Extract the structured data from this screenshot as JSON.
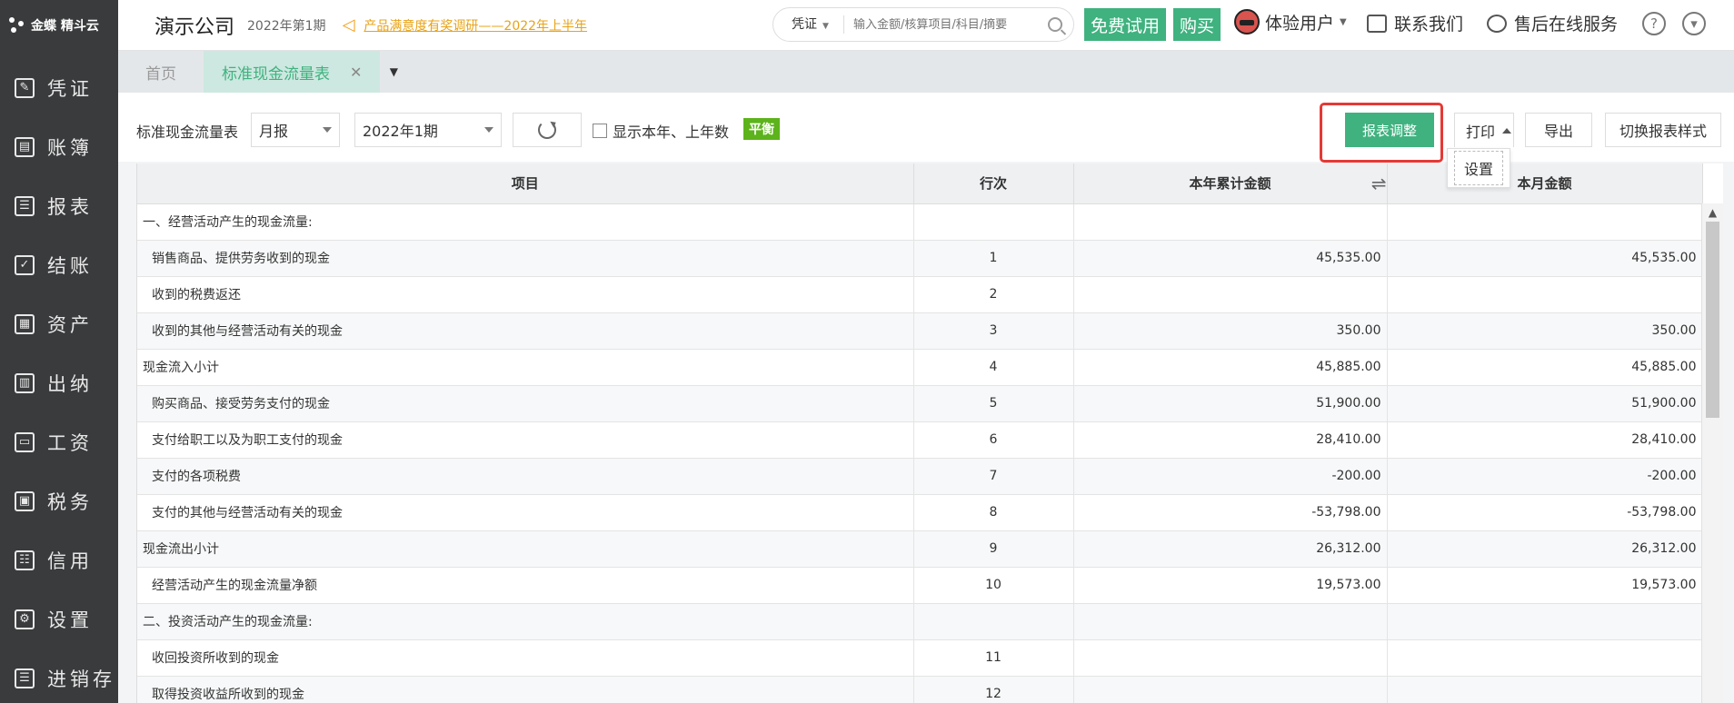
{
  "sidebar": {
    "logo": "金蝶 精斗云",
    "items": [
      {
        "label": "凭证",
        "glyph": "✎"
      },
      {
        "label": "账簿",
        "glyph": "▤"
      },
      {
        "label": "报表",
        "glyph": "☰"
      },
      {
        "label": "结账",
        "glyph": "✓"
      },
      {
        "label": "资产",
        "glyph": "▦"
      },
      {
        "label": "出纳",
        "glyph": "▥"
      },
      {
        "label": "工资",
        "glyph": "▭"
      },
      {
        "label": "税务",
        "glyph": "▣"
      },
      {
        "label": "信用",
        "glyph": "☷"
      },
      {
        "label": "设置",
        "glyph": "⚙"
      },
      {
        "label": "进销存",
        "glyph": "☰"
      }
    ]
  },
  "topbar": {
    "company": "演示公司",
    "period": "2022年第1期",
    "notice": "产品满意度有奖调研——2022年上半年",
    "search_type": "凭证",
    "search_placeholder": "输入金额/核算项目/科目/摘要",
    "free_trial": "免费试用",
    "buy": "购买",
    "user": "体验用户",
    "contact": "联系我们",
    "service": "售后在线服务"
  },
  "tabs": [
    {
      "label": "首页",
      "active": false
    },
    {
      "label": "标准现金流量表",
      "active": true
    }
  ],
  "toolbar": {
    "title": "标准现金流量表",
    "report_type": "月报",
    "period": "2022年1期",
    "show_years_label": "显示本年、上年数",
    "balance_badge": "平衡",
    "adjust_button": "报表调整",
    "print_button": "打印",
    "print_menu_item": "设置",
    "export_button": "导出",
    "switch_style_button": "切换报表样式"
  },
  "colors": {
    "accent_green": "#3fb27f",
    "balance_green": "#5cb31b",
    "highlight_red": "#e53935",
    "notice_orange": "#e8a317",
    "sidebar_bg": "#3a3b3d"
  },
  "table": {
    "headers": [
      "项目",
      "行次",
      "本年累计金额",
      "本月金额"
    ],
    "rows": [
      {
        "item": "一、经营活动产生的现金流量:",
        "line": "",
        "ytd": "",
        "month": "",
        "indent": false
      },
      {
        "item": "销售商品、提供劳务收到的现金",
        "line": "1",
        "ytd": "45,535.00",
        "month": "45,535.00",
        "indent": true
      },
      {
        "item": "收到的税费返还",
        "line": "2",
        "ytd": "",
        "month": "",
        "indent": true
      },
      {
        "item": "收到的其他与经营活动有关的现金",
        "line": "3",
        "ytd": "350.00",
        "month": "350.00",
        "indent": true
      },
      {
        "item": "现金流入小计",
        "line": "4",
        "ytd": "45,885.00",
        "month": "45,885.00",
        "indent": false
      },
      {
        "item": "购买商品、接受劳务支付的现金",
        "line": "5",
        "ytd": "51,900.00",
        "month": "51,900.00",
        "indent": true
      },
      {
        "item": "支付给职工以及为职工支付的现金",
        "line": "6",
        "ytd": "28,410.00",
        "month": "28,410.00",
        "indent": true
      },
      {
        "item": "支付的各项税费",
        "line": "7",
        "ytd": "-200.00",
        "month": "-200.00",
        "indent": true
      },
      {
        "item": "支付的其他与经营活动有关的现金",
        "line": "8",
        "ytd": "-53,798.00",
        "month": "-53,798.00",
        "indent": true
      },
      {
        "item": "现金流出小计",
        "line": "9",
        "ytd": "26,312.00",
        "month": "26,312.00",
        "indent": false
      },
      {
        "item": "经营活动产生的现金流量净额",
        "line": "10",
        "ytd": "19,573.00",
        "month": "19,573.00",
        "indent": true
      },
      {
        "item": "二、投资活动产生的现金流量:",
        "line": "",
        "ytd": "",
        "month": "",
        "indent": false
      },
      {
        "item": "收回投资所收到的现金",
        "line": "11",
        "ytd": "",
        "month": "",
        "indent": true
      },
      {
        "item": "取得投资收益所收到的现金",
        "line": "12",
        "ytd": "",
        "month": "",
        "indent": true
      }
    ]
  }
}
